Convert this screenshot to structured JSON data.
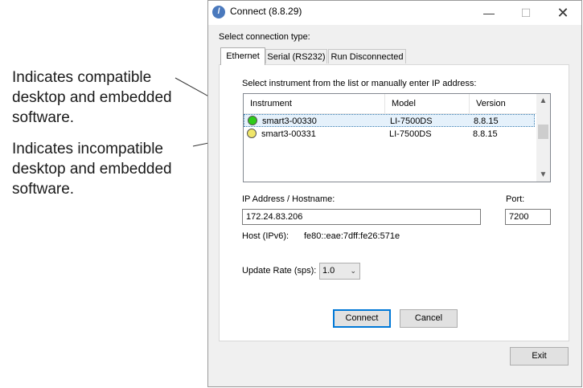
{
  "annotations": [
    {
      "text": "Indicates compatible desktop and embedded software."
    },
    {
      "text": "Indicates incompatible desktop and embedded software."
    }
  ],
  "window": {
    "title": "Connect (8.8.29)",
    "icon": "licor-logo-icon",
    "controls": {
      "minimize": "—",
      "maximize": "☐",
      "close": "✕"
    }
  },
  "dialog": {
    "connection_type_label": "Select connection type:",
    "tabs": [
      {
        "label": "Ethernet",
        "active": true
      },
      {
        "label": "Serial (RS232)",
        "active": false
      },
      {
        "label": "Run Disconnected",
        "active": false
      }
    ],
    "instrument_prompt": "Select instrument from the list or manually enter IP address:",
    "table": {
      "columns": [
        "Instrument",
        "Model",
        "Version"
      ],
      "rows": [
        {
          "instrument": "smart3-00330",
          "model": "LI-7500DS",
          "version": "8.8.15",
          "status_color": "#2ecc1a",
          "selected": true
        },
        {
          "instrument": "smart3-00331",
          "model": "LI-7500DS",
          "version": "8.8.15",
          "status_color": "#f0e66a",
          "selected": false
        }
      ]
    },
    "ip_label": "IP Address / Hostname:",
    "ip_value": "172.24.83.206",
    "port_label": "Port:",
    "port_value": "7200",
    "ipv6_label": "Host (IPv6):",
    "ipv6_value": "fe80::eae:7dff:fe26:571e",
    "update_rate_label": "Update Rate (sps):",
    "update_rate_value": "1.0",
    "connect_label": "Connect",
    "cancel_label": "Cancel",
    "exit_label": "Exit"
  }
}
